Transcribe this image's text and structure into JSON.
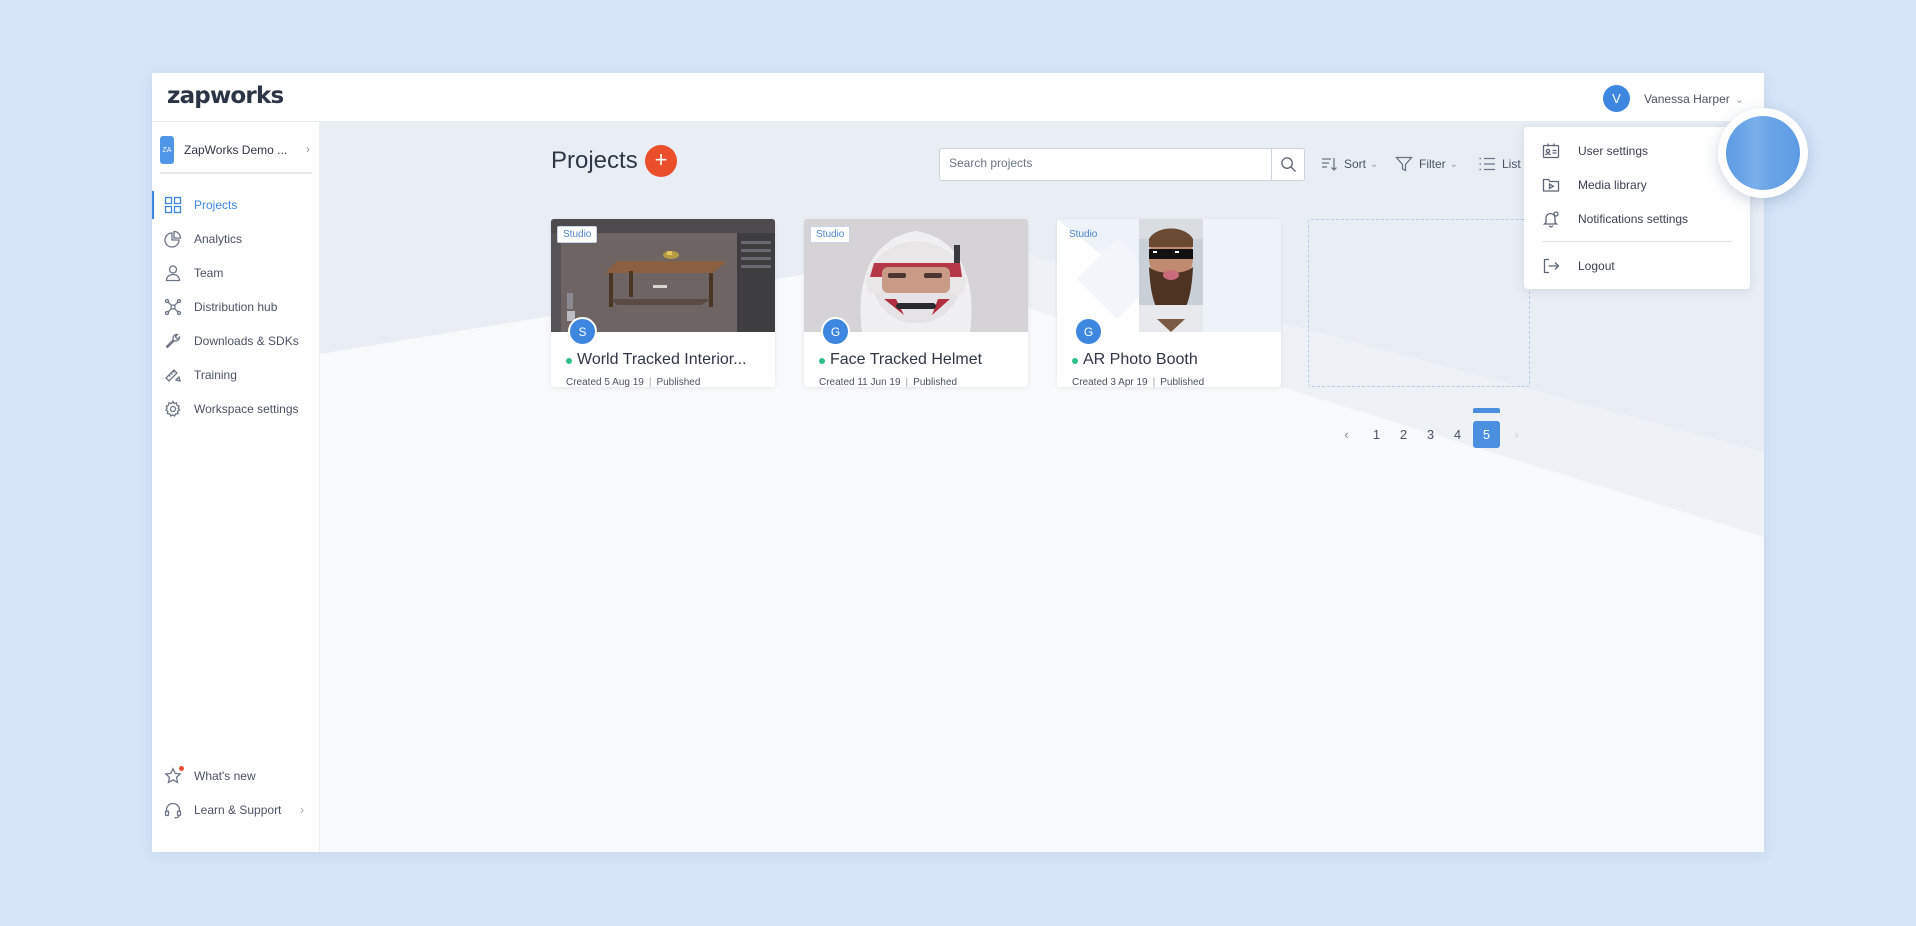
{
  "app": {
    "logo": "zapworks"
  },
  "user": {
    "initial": "V",
    "name": "Vanessa Harper"
  },
  "workspace": {
    "badge": "ZA",
    "name": "ZapWorks Demo ..."
  },
  "sidebar": {
    "items": [
      {
        "label": "Projects",
        "icon": "grid-icon",
        "active": true
      },
      {
        "label": "Analytics",
        "icon": "pie-chart-icon"
      },
      {
        "label": "Team",
        "icon": "person-icon"
      },
      {
        "label": "Distribution hub",
        "icon": "network-icon"
      },
      {
        "label": "Downloads & SDKs",
        "icon": "wrench-icon"
      },
      {
        "label": "Training",
        "icon": "ruler-pencil-icon"
      },
      {
        "label": "Workspace settings",
        "icon": "gear-icon"
      }
    ],
    "bottom": [
      {
        "label": "What's new",
        "icon": "star-icon"
      },
      {
        "label": "Learn & Support",
        "icon": "headset-icon"
      }
    ]
  },
  "main": {
    "title": "Projects",
    "add_label": "+",
    "search": {
      "placeholder": "Search projects"
    },
    "toolbar": {
      "sort": "Sort",
      "filter": "Filter",
      "list": "List"
    }
  },
  "projects": [
    {
      "tag": "Studio",
      "avatar": "S",
      "title": "World Tracked Interior...",
      "created": "Created 5 Aug 19",
      "status": "Published"
    },
    {
      "tag": "Studio",
      "avatar": "G",
      "title": "Face Tracked Helmet",
      "created": "Created 11 Jun 19",
      "status": "Published"
    },
    {
      "tag": "Studio",
      "avatar": "G",
      "title": "AR Photo Booth",
      "created": "Created 3 Apr 19",
      "status": "Published"
    }
  ],
  "pagination": {
    "pages": [
      "1",
      "2",
      "3",
      "4",
      "5"
    ],
    "current": "5",
    "prev": "‹",
    "next": "›"
  },
  "user_menu": {
    "items": [
      {
        "label": "User settings",
        "icon": "id-card-icon"
      },
      {
        "label": "Media library",
        "icon": "folder-play-icon"
      },
      {
        "label": "Notifications settings",
        "icon": "bell-gear-icon"
      },
      {
        "label": "Logout",
        "icon": "logout-icon"
      }
    ]
  },
  "colors": {
    "accent": "#3d87e0",
    "add_button": "#ea4e2b",
    "live": "#2fc08a",
    "background": "#d6e5f7"
  }
}
